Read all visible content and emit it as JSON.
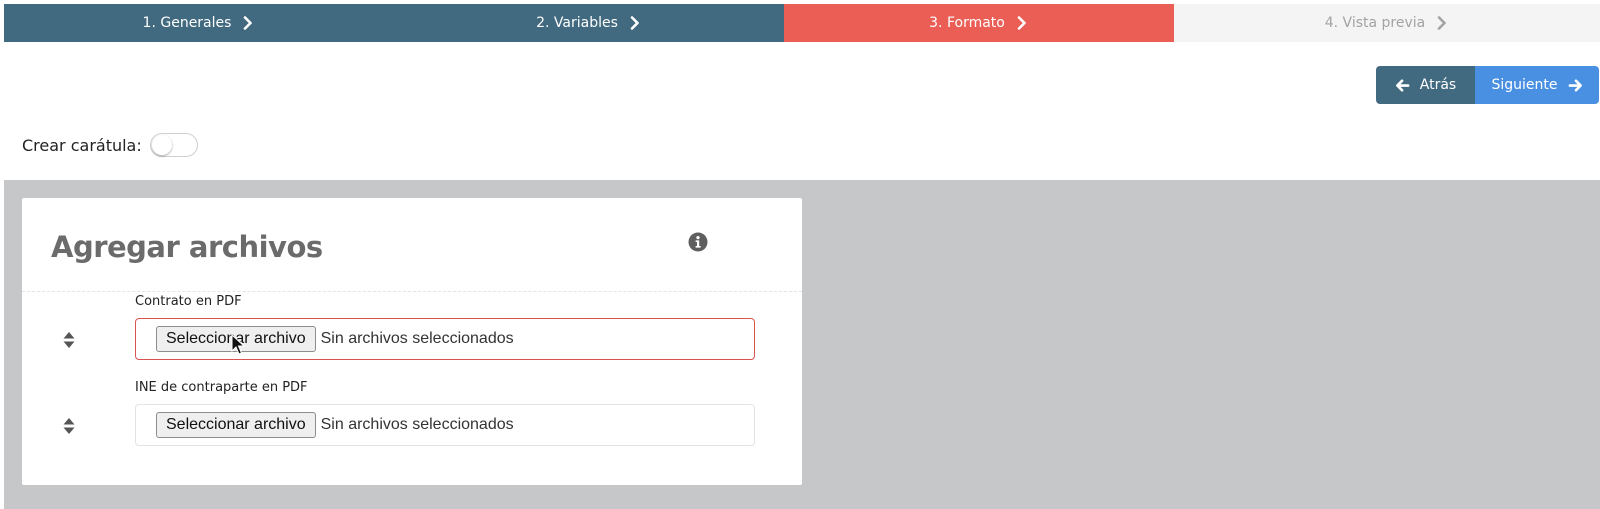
{
  "stepper": {
    "steps": [
      {
        "label": "1. Generales",
        "state": "done"
      },
      {
        "label": "2. Variables",
        "state": "done"
      },
      {
        "label": "3. Formato",
        "state": "active"
      },
      {
        "label": "4. Vista previa",
        "state": "pending"
      }
    ]
  },
  "nav": {
    "back_label": "Atrás",
    "next_label": "Siguiente"
  },
  "cover": {
    "label": "Crear carátula:",
    "enabled": false
  },
  "files_card": {
    "title": "Agregar archivos",
    "fields": [
      {
        "label": "Contrato en PDF",
        "button": "Seleccionar archivo",
        "status": "Sin archivos seleccionados",
        "invalid": true
      },
      {
        "label": "INE de contraparte en PDF",
        "button": "Seleccionar archivo",
        "status": "Sin archivos seleccionados",
        "invalid": false
      }
    ]
  },
  "colors": {
    "done": "#41697f",
    "active": "#ea5e55",
    "pending": "#f4f4f4",
    "next_button": "#4a90e2",
    "workspace": "#c6c7c9",
    "error_border": "#d9534f"
  },
  "icons": {
    "step_separator": "chevron-right-icon",
    "back": "arrow-left-icon",
    "next": "arrow-right-icon",
    "info": "info-circle-icon",
    "reorder": "sort-icon"
  }
}
